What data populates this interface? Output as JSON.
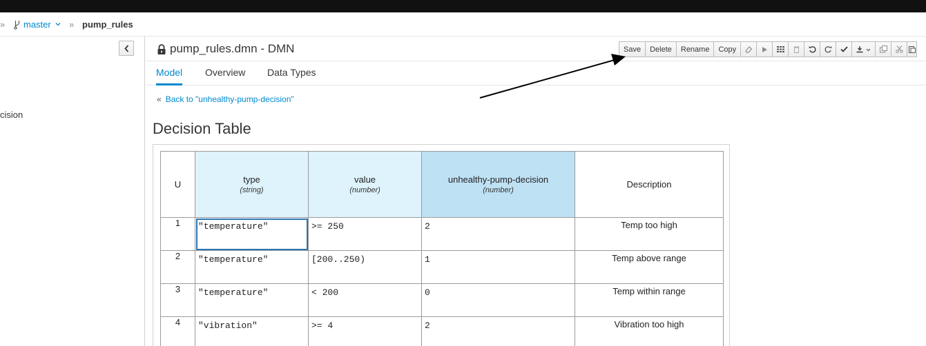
{
  "breadcrumb": {
    "sep": "»",
    "branch": "master",
    "project": "pump_rules"
  },
  "left_panel": {
    "partial_item": "cision"
  },
  "editor": {
    "title": "pump_rules.dmn - DMN",
    "toolbar": {
      "save": "Save",
      "delete": "Delete",
      "rename": "Rename",
      "copy": "Copy"
    },
    "tabs": [
      "Model",
      "Overview",
      "Data Types"
    ],
    "back_chevron": "«",
    "back_link": "Back to \"unhealthy-pump-decision\"",
    "section_title": "Decision Table"
  },
  "decision_table": {
    "hit_policy": "U",
    "columns": [
      {
        "name": "type",
        "type": "(string)",
        "kind": "input"
      },
      {
        "name": "value",
        "type": "(number)",
        "kind": "input"
      },
      {
        "name": "unhealthy-pump-decision",
        "type": "(number)",
        "kind": "output"
      },
      {
        "name": "Description",
        "type": "",
        "kind": "annotation"
      }
    ],
    "rows": [
      {
        "n": "1",
        "type": "\"temperature\"",
        "value": ">= 250",
        "out": "2",
        "desc": "Temp too high"
      },
      {
        "n": "2",
        "type": "\"temperature\"",
        "value": "[200..250)",
        "out": "1",
        "desc": "Temp above range"
      },
      {
        "n": "3",
        "type": "\"temperature\"",
        "value": "< 200",
        "out": "0",
        "desc": "Temp within range"
      },
      {
        "n": "4",
        "type": "\"vibration\"",
        "value": ">= 4",
        "out": "2",
        "desc": "Vibration too high"
      }
    ]
  },
  "colors": {
    "link": "#0088ce",
    "input_header": "#def3fc",
    "output_header": "#bee1f4",
    "selection": "#2a76b5"
  }
}
